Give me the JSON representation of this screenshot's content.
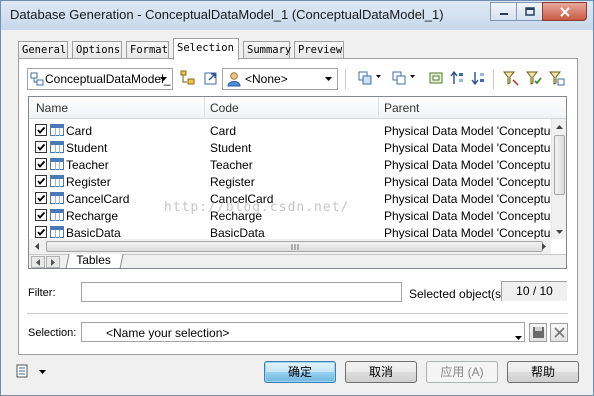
{
  "window": {
    "title": "Database Generation - ConceptualDataModel_1 (ConceptualDataModel_1)"
  },
  "tabs": [
    {
      "label": "General"
    },
    {
      "label": "Options"
    },
    {
      "label": "Format"
    },
    {
      "label": "Selection",
      "active": true
    },
    {
      "label": "Summary"
    },
    {
      "label": "Preview"
    }
  ],
  "toolbar": {
    "model_combo_value": "ConceptualDataModel_",
    "owner_combo_value": "<None>",
    "icons": [
      "model-tree-icon",
      "open-model-icon",
      "owner-icon",
      "select-all-icon",
      "deselect-icon",
      "package-icon",
      "move-up-icon",
      "move-down-icon",
      "filter-icon",
      "filter-checked-icon",
      "filter-options-icon"
    ]
  },
  "grid": {
    "columns": [
      "Name",
      "Code",
      "Parent"
    ],
    "rows": [
      {
        "name": "Card",
        "code": "Card",
        "parent": "Physical Data Model 'Conceptu...",
        "checked": true
      },
      {
        "name": "Student",
        "code": "Student",
        "parent": "Physical Data Model 'Conceptu...",
        "checked": true
      },
      {
        "name": "Teacher",
        "code": "Teacher",
        "parent": "Physical Data Model 'Conceptu...",
        "checked": true
      },
      {
        "name": "Register",
        "code": "Register",
        "parent": "Physical Data Model 'Conceptu...",
        "checked": true
      },
      {
        "name": "CancelCard",
        "code": "CancelCard",
        "parent": "Physical Data Model 'Conceptu...",
        "checked": true
      },
      {
        "name": "Recharge",
        "code": "Recharge",
        "parent": "Physical Data Model 'Conceptu...",
        "checked": true
      },
      {
        "name": "BasicData",
        "code": "BasicData",
        "parent": "Physical Data Model 'Conceptu...",
        "checked": true
      }
    ],
    "sheet_tab": "Tables",
    "watermark": "http://blog.csdn.net/"
  },
  "filter": {
    "label": "Filter:",
    "value": ""
  },
  "selected_objects": {
    "label": "Selected object(s):",
    "value": "10 / 10"
  },
  "selection": {
    "label": "Selection:",
    "placeholder": "<Name your selection>"
  },
  "buttons": {
    "ok": "确定",
    "cancel": "取消",
    "apply": "应用 (A)",
    "help": "帮助"
  },
  "colors": {
    "accent": "#3c7fb1",
    "titlebar": "#c7d8ec",
    "close": "#c85a45"
  }
}
